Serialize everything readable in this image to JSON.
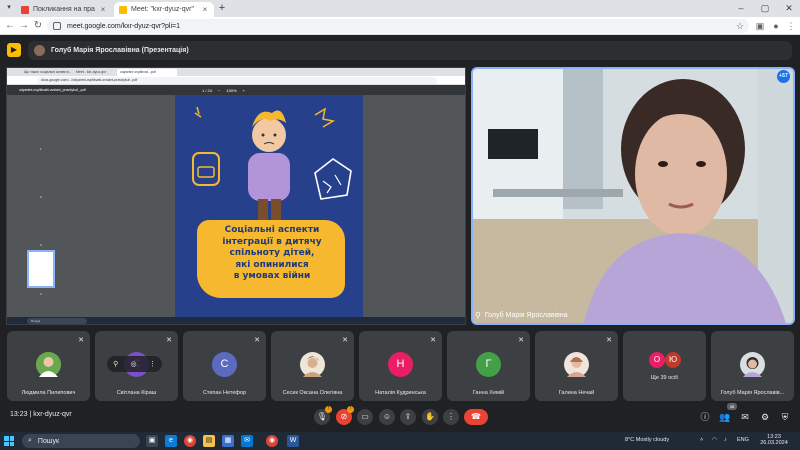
{
  "browser": {
    "tabs": [
      {
        "title": "Покликання на практику \"С",
        "favicon_color": "#ea4335",
        "active": false
      },
      {
        "title": "Meet: \"kxr-dyuz-qvr\"",
        "favicon_color": "#fbbc04",
        "active": true
      }
    ],
    "url": "meet.google.com/kxr-dyuz-qvr?pli=1"
  },
  "meet": {
    "presenter_chip": "Голуб Марія Ярославівна (Презентація)",
    "meeting_code": "kxr-dyuz-qvr",
    "time": "13:23",
    "people_count": "48",
    "camera_name": "Голуб Марія Ярославівна",
    "camera_badge": "+57",
    "accent": "#8ab4f8"
  },
  "shared_screen": {
    "tabs": [
      "Що такоє соціальні аспекти...",
      "Meet - kxr-dyuz-qvr",
      "odyantni ovplikvat...pdf"
    ],
    "url": "docs.google.com/.../odyantni-ovplikvati-ovsiani-pravdykuf...pdf",
    "pdf_filename": "odyantni-ovplikvatii-ovsiani_pravdykuf_.pdf",
    "page_counter": "1 / 24",
    "zoom": "100%",
    "thumb_pages": [
      "1",
      "2",
      "3",
      "4"
    ],
    "poster_lines": [
      "Соціальні аспекти",
      "інтеграції в дитячу",
      "спільноту дітей,",
      "які опинилися",
      "в умовах війни"
    ],
    "mini_taskbar_search": "Пошук"
  },
  "participants": [
    {
      "name": "Людмила Пилипович",
      "initial": "",
      "color": "#6aa84f",
      "kind": "photo"
    },
    {
      "name": "Світлана Кіраш",
      "initial": "С",
      "color": "#7b4fc7",
      "kind": "letter",
      "hover": true
    },
    {
      "name": "Степан Нетефор",
      "initial": "С",
      "color": "#5c6bc0",
      "kind": "letter"
    },
    {
      "name": "Сесик Оксана Олегівна",
      "initial": "",
      "color": "#c9a27e",
      "kind": "photo"
    },
    {
      "name": "Наталія Кудринська",
      "initial": "Н",
      "color": "#e91e63",
      "kind": "letter"
    },
    {
      "name": "Ганна Хемій",
      "initial": "Г",
      "color": "#43a047",
      "kind": "letter"
    },
    {
      "name": "Галина Нечай",
      "initial": "",
      "color": "#d7a690",
      "kind": "photo"
    },
    {
      "name": "Ще 39 осіб",
      "initial": "",
      "color": "#e91e63",
      "kind": "more"
    },
    {
      "name": "Голуб Марія Ярославів...",
      "initial": "",
      "color": "#8a6b5a",
      "kind": "photo"
    }
  ],
  "more_avatars": [
    "О",
    "Ю"
  ],
  "windows": {
    "search_placeholder": "Пошук",
    "weather": "8°C  Mostly cloudy",
    "lang": "ENG",
    "clock_time": "13:23",
    "clock_date": "26.03.2024"
  }
}
